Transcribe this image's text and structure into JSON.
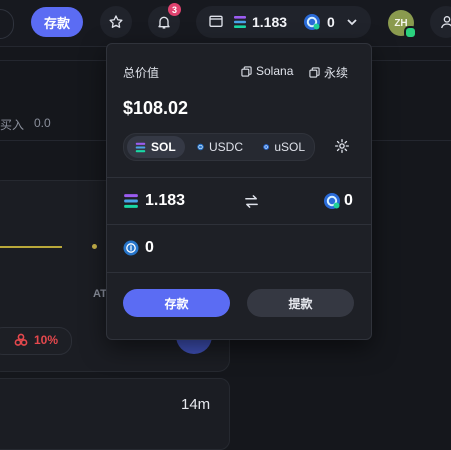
{
  "topbar": {
    "deposit_label": "存款",
    "notification_count": "3",
    "wallet": {
      "sol_balance": "1.183",
      "points_balance": "0"
    },
    "avatar_initials": "ZH"
  },
  "background": {
    "buy_label": "买入",
    "buy_value": "0.0",
    "market_label": "AT",
    "pill_value": "10%",
    "time_label": "14m"
  },
  "panel": {
    "total_label": "总价值",
    "copy_links": [
      "Solana",
      "永续"
    ],
    "total_value": "$108.02",
    "tokens": [
      {
        "label": "SOL",
        "icon": "solana-icon",
        "active": true
      },
      {
        "label": "USDC",
        "icon": "usdc-icon",
        "active": false
      },
      {
        "label": "uSOL",
        "icon": "usol-icon",
        "active": false
      }
    ],
    "balances": {
      "sol": "1.183",
      "points": "0",
      "usdc": "0"
    },
    "deposit_label": "存款",
    "withdraw_label": "提款"
  },
  "colors": {
    "accent": "#5b6cf3",
    "notification": "#e0426f",
    "online": "#2bd17e",
    "negative": "#e5484d"
  }
}
